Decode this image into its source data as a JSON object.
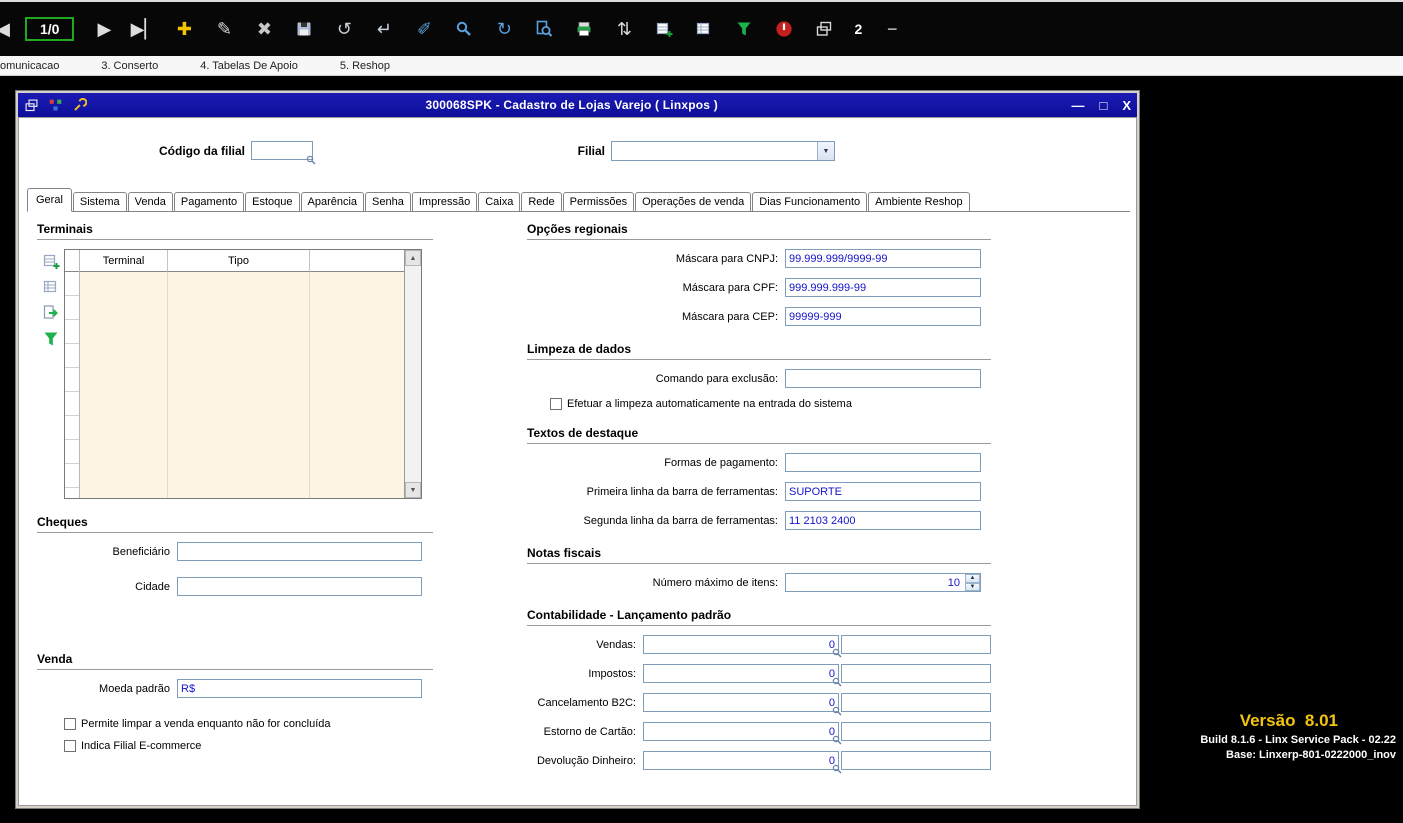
{
  "colors": {
    "titlebar_blue": "#1212a8",
    "value_text_blue": "#1414c8",
    "version_yellow": "#f2c40f",
    "counter_green": "#20a820",
    "grid_body_cream": "#fcf5e4",
    "toolbar_black": "#070707"
  },
  "glyphs": {
    "dropdown": "▼",
    "scroll_up": "▲",
    "scroll_down": "▼",
    "spin_up": "▲",
    "spin_down": "▼"
  },
  "toolbar": {
    "prev_glyph": "◀",
    "record_counter": "1/0",
    "next_glyph": "▶",
    "last_glyph": "▶▏",
    "window_count": "2",
    "minimize_glyph": "−",
    "icons": [
      {
        "name": "add-icon",
        "kind": "glyph",
        "glyph": "✚",
        "color": "#f5c400"
      },
      {
        "name": "edit-icon",
        "kind": "glyph",
        "glyph": "✎",
        "color": "#d8d8d8"
      },
      {
        "name": "delete-icon",
        "kind": "glyph",
        "glyph": "✖",
        "color": "#c8c8c8"
      },
      {
        "name": "save-icon",
        "kind": "disk",
        "color": "#aebdd4"
      },
      {
        "name": "revert-icon",
        "kind": "glyph",
        "glyph": "↺",
        "color": "#c8d0dc"
      },
      {
        "name": "confirm-icon",
        "kind": "glyph",
        "glyph": "↵",
        "color": "#c8d0dc"
      },
      {
        "name": "brush-icon",
        "kind": "glyph",
        "glyph": "✐",
        "color": "#5aa0dc"
      },
      {
        "name": "search-icon",
        "kind": "mag",
        "color": "#5aa0dc"
      },
      {
        "name": "refresh-icon",
        "kind": "glyph",
        "glyph": "↻",
        "color": "#5aa0dc"
      },
      {
        "name": "preview-icon",
        "kind": "magdoc",
        "color": "#5aa0dc"
      },
      {
        "name": "print-export-icon",
        "kind": "printer",
        "color": "#25a04a"
      },
      {
        "name": "sort-icon",
        "kind": "glyph",
        "glyph": "⇅",
        "color": "#d8d8d8"
      },
      {
        "name": "report-add-icon",
        "kind": "gridadd",
        "color": "#98a8c0"
      },
      {
        "name": "report-icon",
        "kind": "grid",
        "color": "#98a8c0"
      },
      {
        "name": "filter-icon",
        "kind": "funnel",
        "color": "#1db34a"
      },
      {
        "name": "exit-icon",
        "kind": "power",
        "color": "#c42020"
      },
      {
        "name": "cascade-windows-icon",
        "kind": "cascade",
        "color": "#d8d8d8"
      }
    ]
  },
  "menubar": {
    "items": [
      "omunicacao",
      "3. Conserto",
      "4. Tabelas De Apoio",
      "5. Reshop"
    ]
  },
  "window": {
    "title": "300068SPK - Cadastro de Lojas Varejo ( Linxpos )",
    "titlebar_icons": [
      {
        "name": "window-icon",
        "kind": "cascade",
        "color": "#e8e8e8"
      },
      {
        "name": "modules-icon",
        "kind": "tree",
        "color": "#3fae49"
      },
      {
        "name": "wrench-icon",
        "kind": "wrench",
        "color": "#f0c020"
      }
    ],
    "controls": {
      "minimize": "—",
      "maximize": "□",
      "close": "X"
    },
    "header": {
      "codigo_label": "Código da filial",
      "codigo_value": "",
      "filial_label": "Filial",
      "filial_value": ""
    },
    "active_tab": "Geral",
    "tabs": [
      "Geral",
      "Sistema",
      "Venda",
      "Pagamento",
      "Estoque",
      "Aparência",
      "Senha",
      "Impressão",
      "Caixa",
      "Rede",
      "Permissões",
      "Operações de venda",
      "Dias Funcionamento",
      "Ambiente Reshop"
    ],
    "terminais": {
      "title": "Terminais",
      "columns": [
        "Terminal",
        "Tipo"
      ],
      "rows": [],
      "side_icons": [
        {
          "name": "grid-add-icon",
          "kind": "gridadd",
          "color": "#98a8c0"
        },
        {
          "name": "grid-report-icon",
          "kind": "grid",
          "color": "#98a8c0"
        },
        {
          "name": "grid-export-icon",
          "kind": "export",
          "color": "#1db34a"
        },
        {
          "name": "grid-filter-icon",
          "kind": "funnel",
          "color": "#1db34a"
        }
      ]
    },
    "cheques": {
      "title": "Cheques",
      "beneficiario_label": "Beneficiário",
      "beneficiario_value": "",
      "cidade_label": "Cidade",
      "cidade_value": ""
    },
    "venda": {
      "title": "Venda",
      "moeda_label": "Moeda padrão",
      "moeda_value": "R$",
      "check_limpar": "Permite limpar a venda enquanto não for concluída",
      "check_ecommerce": "Indica Filial E-commerce"
    },
    "opcoes_regionais": {
      "title": "Opções regionais",
      "rows": [
        {
          "label": "Máscara para CNPJ:",
          "value": "99.999.999/9999-99"
        },
        {
          "label": "Máscara para CPF:",
          "value": "999.999.999-99"
        },
        {
          "label": "Máscara para CEP:",
          "value": "99999-999"
        }
      ]
    },
    "limpeza": {
      "title": "Limpeza de dados",
      "comando_label": "Comando para exclusão:",
      "comando_value": "",
      "check_auto": "Efetuar a limpeza automaticamente na entrada do sistema"
    },
    "textos": {
      "title": "Textos de destaque",
      "rows": [
        {
          "label": "Formas de pagamento:",
          "value": ""
        },
        {
          "label": "Primeira linha da barra de ferramentas:",
          "value": "SUPORTE"
        },
        {
          "label": "Segunda linha da barra de ferramentas:",
          "value": "11 2103 2400"
        }
      ]
    },
    "notas": {
      "title": "Notas fiscais",
      "label": "Número máximo de itens:",
      "value": "10"
    },
    "contabilidade": {
      "title": "Contabilidade - Lançamento padrão",
      "rows": [
        {
          "label": "Vendas:",
          "code": "0",
          "desc": ""
        },
        {
          "label": "Impostos:",
          "code": "0",
          "desc": ""
        },
        {
          "label": "Cancelamento B2C:",
          "code": "0",
          "desc": ""
        },
        {
          "label": "Estorno de Cartão:",
          "code": "0",
          "desc": ""
        },
        {
          "label": "Devolução Dinheiro:",
          "code": "0",
          "desc": ""
        }
      ]
    }
  },
  "version_panel": {
    "version": "Versão  8.01",
    "build": "Build 8.1.6 - Linx Service Pack - 02.22",
    "base": "Base: Linxerp-801-0222000_inov"
  }
}
